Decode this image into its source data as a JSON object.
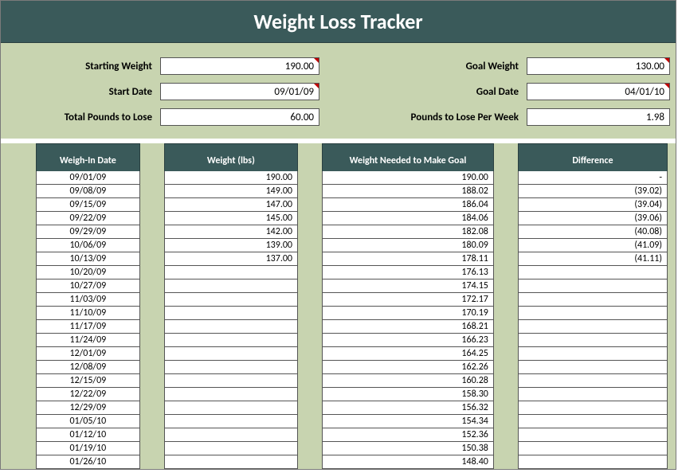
{
  "title": "Weight Loss Tracker",
  "summary": {
    "labels": {
      "starting_weight": "Starting Weight",
      "goal_weight": "Goal Weight",
      "start_date": "Start Date",
      "goal_date": "Goal Date",
      "total_lose": "Total Pounds to Lose",
      "per_week": "Pounds to Lose Per Week"
    },
    "values": {
      "starting_weight": "190.00",
      "goal_weight": "130.00",
      "start_date": "09/01/09",
      "goal_date": "04/01/10",
      "total_lose": "60.00",
      "per_week": "1.98"
    }
  },
  "columns": {
    "date": "Weigh-In Date",
    "weight": "Weight (lbs)",
    "goal": "Weight Needed to Make Goal",
    "diff": "Difference"
  },
  "rows": [
    {
      "date": "09/01/09",
      "weight": "190.00",
      "goal": "190.00",
      "diff": "-"
    },
    {
      "date": "09/08/09",
      "weight": "149.00",
      "goal": "188.02",
      "diff": "(39.02)"
    },
    {
      "date": "09/15/09",
      "weight": "147.00",
      "goal": "186.04",
      "diff": "(39.04)"
    },
    {
      "date": "09/22/09",
      "weight": "145.00",
      "goal": "184.06",
      "diff": "(39.06)"
    },
    {
      "date": "09/29/09",
      "weight": "142.00",
      "goal": "182.08",
      "diff": "(40.08)"
    },
    {
      "date": "10/06/09",
      "weight": "139.00",
      "goal": "180.09",
      "diff": "(41.09)"
    },
    {
      "date": "10/13/09",
      "weight": "137.00",
      "goal": "178.11",
      "diff": "(41.11)"
    },
    {
      "date": "10/20/09",
      "weight": "",
      "goal": "176.13",
      "diff": ""
    },
    {
      "date": "10/27/09",
      "weight": "",
      "goal": "174.15",
      "diff": ""
    },
    {
      "date": "11/03/09",
      "weight": "",
      "goal": "172.17",
      "diff": ""
    },
    {
      "date": "11/10/09",
      "weight": "",
      "goal": "170.19",
      "diff": ""
    },
    {
      "date": "11/17/09",
      "weight": "",
      "goal": "168.21",
      "diff": ""
    },
    {
      "date": "11/24/09",
      "weight": "",
      "goal": "166.23",
      "diff": ""
    },
    {
      "date": "12/01/09",
      "weight": "",
      "goal": "164.25",
      "diff": ""
    },
    {
      "date": "12/08/09",
      "weight": "",
      "goal": "162.26",
      "diff": ""
    },
    {
      "date": "12/15/09",
      "weight": "",
      "goal": "160.28",
      "diff": ""
    },
    {
      "date": "12/22/09",
      "weight": "",
      "goal": "158.30",
      "diff": ""
    },
    {
      "date": "12/29/09",
      "weight": "",
      "goal": "156.32",
      "diff": ""
    },
    {
      "date": "01/05/10",
      "weight": "",
      "goal": "154.34",
      "diff": ""
    },
    {
      "date": "01/12/10",
      "weight": "",
      "goal": "152.36",
      "diff": ""
    },
    {
      "date": "01/19/10",
      "weight": "",
      "goal": "150.38",
      "diff": ""
    },
    {
      "date": "01/26/10",
      "weight": "",
      "goal": "148.40",
      "diff": ""
    }
  ]
}
